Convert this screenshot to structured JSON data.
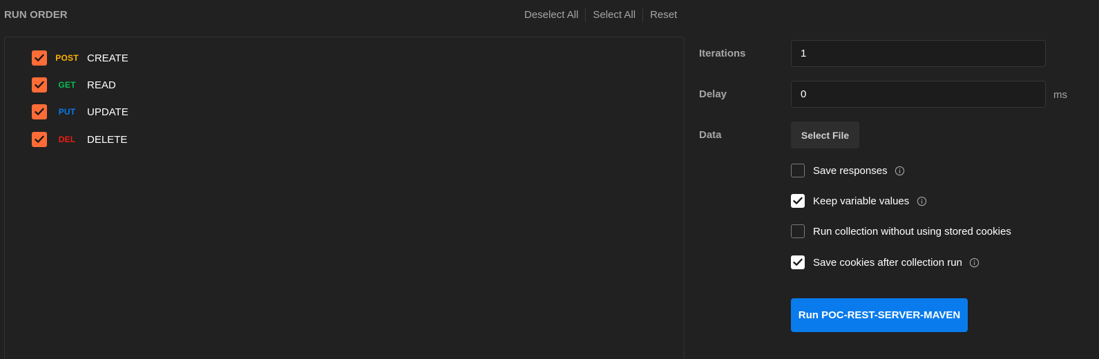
{
  "header": {
    "title": "RUN ORDER",
    "actions": [
      "Deselect All",
      "Select All",
      "Reset"
    ]
  },
  "requests": [
    {
      "method": "POST",
      "name": "CREATE",
      "checked": true,
      "method_color": "#ffb400"
    },
    {
      "method": "GET",
      "name": "READ",
      "checked": true,
      "method_color": "#0cbb52"
    },
    {
      "method": "PUT",
      "name": "UPDATE",
      "checked": true,
      "method_color": "#097bed"
    },
    {
      "method": "DEL",
      "name": "DELETE",
      "checked": true,
      "method_color": "#eb2013"
    }
  ],
  "settings": {
    "iterations": {
      "label": "Iterations",
      "value": "1"
    },
    "delay": {
      "label": "Delay",
      "value": "0",
      "unit": "ms"
    },
    "data": {
      "label": "Data",
      "button": "Select File"
    },
    "options": [
      {
        "label": "Save responses",
        "checked": false,
        "info": true
      },
      {
        "label": "Keep variable values",
        "checked": true,
        "info": true
      },
      {
        "label": "Run collection without using stored cookies",
        "checked": false,
        "info": false
      },
      {
        "label": "Save cookies after collection run",
        "checked": true,
        "info": true
      }
    ]
  },
  "run_button": {
    "label": "Run POC-REST-SERVER-MAVEN"
  },
  "colors": {
    "accent_checkbox": "#ff6c37",
    "primary_button": "#097bed",
    "background": "#212121"
  },
  "icons": {
    "check": "check-icon",
    "info": "info-icon"
  }
}
